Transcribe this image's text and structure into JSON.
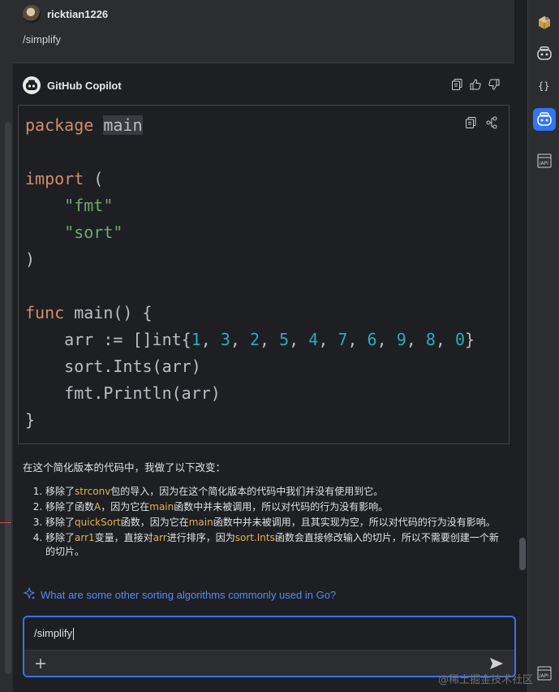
{
  "user": {
    "name": "ricktian1226",
    "message": "/simplify"
  },
  "assistant": {
    "name": "GitHub Copilot"
  },
  "code": {
    "lines": [
      [
        {
          "t": "package",
          "c": "kw"
        },
        {
          "t": " "
        },
        {
          "t": "main",
          "c": "hl"
        }
      ],
      [],
      [
        {
          "t": "import",
          "c": "kw"
        },
        {
          "t": " ("
        }
      ],
      [
        {
          "t": "    "
        },
        {
          "t": "\"fmt\"",
          "c": "str"
        }
      ],
      [
        {
          "t": "    "
        },
        {
          "t": "\"sort\"",
          "c": "str"
        }
      ],
      [
        {
          "t": ")"
        }
      ],
      [],
      [
        {
          "t": "func",
          "c": "kw"
        },
        {
          "t": " main() {"
        }
      ],
      [
        {
          "t": "    arr := []int{"
        },
        {
          "t": "1",
          "c": "num"
        },
        {
          "t": ", "
        },
        {
          "t": "3",
          "c": "num"
        },
        {
          "t": ", "
        },
        {
          "t": "2",
          "c": "num"
        },
        {
          "t": ", "
        },
        {
          "t": "5",
          "c": "num"
        },
        {
          "t": ", "
        },
        {
          "t": "4",
          "c": "num"
        },
        {
          "t": ", "
        },
        {
          "t": "7",
          "c": "num"
        },
        {
          "t": ", "
        },
        {
          "t": "6",
          "c": "num"
        },
        {
          "t": ", "
        },
        {
          "t": "9",
          "c": "num"
        },
        {
          "t": ", "
        },
        {
          "t": "8",
          "c": "num"
        },
        {
          "t": ", "
        },
        {
          "t": "0",
          "c": "num"
        },
        {
          "t": "}"
        }
      ],
      [
        {
          "t": "    sort.Ints(arr)"
        }
      ],
      [
        {
          "t": "    fmt.Println(arr)"
        }
      ],
      [
        {
          "t": "}"
        }
      ]
    ]
  },
  "answer": {
    "intro": "在这个简化版本的代码中，我做了以下改变：",
    "items": [
      [
        {
          "t": "移除了"
        },
        {
          "t": "strconv",
          "c": "code-ref"
        },
        {
          "t": "包的导入，因为在这个简化版本的代码中我们并没有使用到它。"
        }
      ],
      [
        {
          "t": "移除了函数"
        },
        {
          "t": "A",
          "c": "code-ref"
        },
        {
          "t": "，因为它在"
        },
        {
          "t": "main",
          "c": "code-ref"
        },
        {
          "t": "函数中并未被调用，所以对代码的行为没有影响。"
        }
      ],
      [
        {
          "t": "移除了"
        },
        {
          "t": "quickSort",
          "c": "code-ref"
        },
        {
          "t": "函数，因为它在"
        },
        {
          "t": "main",
          "c": "code-ref"
        },
        {
          "t": "函数中并未被调用，且其实现为空，所以对代码的行为没有影响。"
        }
      ],
      [
        {
          "t": "移除了"
        },
        {
          "t": "arr1",
          "c": "code-ref"
        },
        {
          "t": "变量，直接对"
        },
        {
          "t": "arr",
          "c": "code-ref"
        },
        {
          "t": "进行排序，因为"
        },
        {
          "t": "sort.Ints",
          "c": "code-ref"
        },
        {
          "t": "函数会直接修改输入的切片，所以不需要创建一个新的切片。"
        }
      ]
    ]
  },
  "suggestion": "What are some other sorting algorithms commonly used in Go?",
  "input": {
    "value": "/simplify"
  },
  "watermark": "@稀土掘金技术社区",
  "colors": {
    "accent": "#3574f0",
    "link": "#548af7"
  }
}
